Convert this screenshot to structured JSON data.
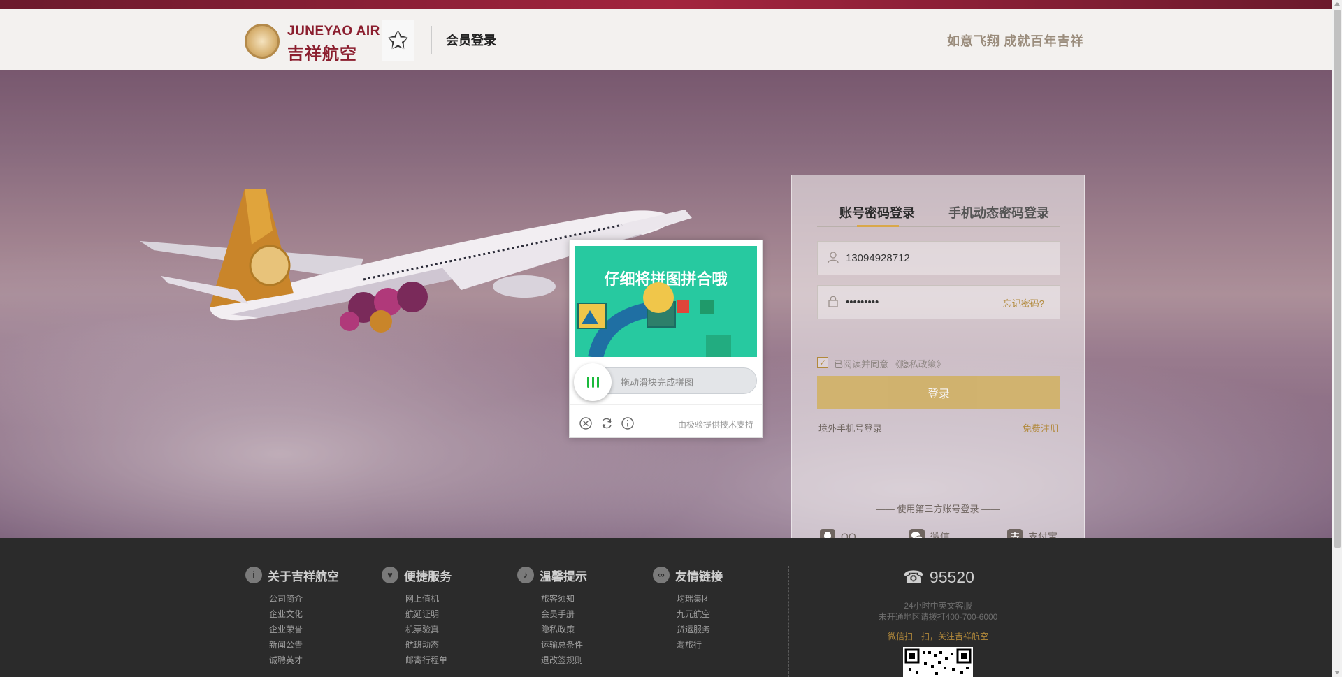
{
  "header": {
    "logo_en": "JUNEYAO AIR",
    "logo_cn": "吉祥航空",
    "title": "会员登录",
    "slogan": "如意飞翔 成就百年吉祥"
  },
  "login": {
    "tabs": [
      {
        "label": "账号密码登录",
        "active": true
      },
      {
        "label": "手机动态密码登录",
        "active": false
      }
    ],
    "username_value": "13094928712",
    "password_value": "•••••••••",
    "forgot_label": "忘记密码?",
    "agree_text": "已阅读并同意 《隐私政策》",
    "agree_checked": true,
    "login_button": "登录",
    "overseas_link": "境外手机号登录",
    "register_link": "免费注册",
    "thirdparty_title": "—— 使用第三方账号登录 ——",
    "thirdparty": [
      {
        "label": "QQ",
        "icon": "qq-icon"
      },
      {
        "label": "微信",
        "icon": "wechat-icon"
      },
      {
        "label": "支付宝",
        "icon": "alipay-icon"
      }
    ]
  },
  "captcha": {
    "headline": "仔细将拼图拼合哦",
    "slider_placeholder": "拖动滑块完成拼图",
    "brand": "由极验提供技术支持"
  },
  "footer": {
    "columns": [
      {
        "title": "关于吉祥航空",
        "icon": "info-icon",
        "links": [
          "公司简介",
          "企业文化",
          "企业荣誉",
          "新闻公告",
          "诚聘英才"
        ]
      },
      {
        "title": "便捷服务",
        "icon": "heart-icon",
        "links": [
          "网上值机",
          "航延证明",
          "机票验真",
          "航班动态",
          "邮寄行程单"
        ]
      },
      {
        "title": "温馨提示",
        "icon": "bell-icon",
        "links": [
          "旅客须知",
          "会员手册",
          "隐私政策",
          "运输总条件",
          "退改签规则"
        ]
      },
      {
        "title": "友情链接",
        "icon": "link-icon",
        "links": [
          "均瑶集团",
          "九元航空",
          "货运服务",
          "淘旅行"
        ]
      }
    ],
    "hotline_number": "95520",
    "hotline_sub1": "24小时中英文客服",
    "hotline_sub2": "未开通地区请拨打400-700-6000",
    "wechat_follow": "微信扫一扫，关注吉祥航空"
  },
  "colors": {
    "brand_red": "#8b1e2e",
    "gold": "#b2893b",
    "login_button": "#d1b05f",
    "captcha_bg": "#27c9a0"
  }
}
